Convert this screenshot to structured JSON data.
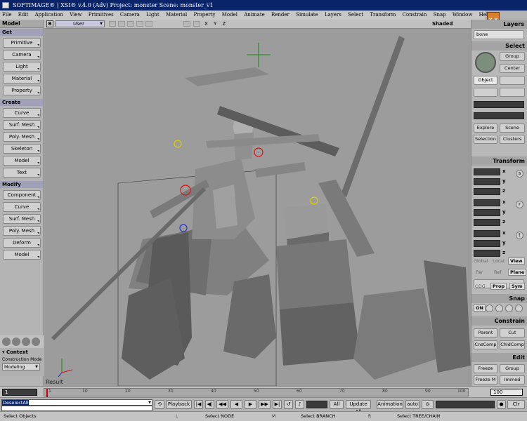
{
  "window": {
    "title": "SOFTIMAGE® | XSI® v.4.0 (Adv) Project: monster    Scene: monster_v1"
  },
  "menu": [
    "File",
    "Edit",
    "Application",
    "View",
    "Primitives",
    "Camera",
    "Light",
    "Material",
    "Property",
    "Model",
    "Animate",
    "Render",
    "Simulate",
    "Layers",
    "Select",
    "Transform",
    "Constrain",
    "Snap",
    "Window",
    "Help"
  ],
  "left_panel": {
    "title": "Model",
    "get_label": "Get",
    "get_buttons": [
      "Primitive",
      "Camera",
      "Light",
      "Material",
      "Property"
    ],
    "create_label": "Create",
    "create_buttons": [
      "Curve",
      "Surf. Mesh",
      "Poly. Mesh",
      "Skeleton",
      "Model",
      "Text"
    ],
    "modify_label": "Modify",
    "modify_buttons": [
      "Component",
      "Curve",
      "Surf. Mesh",
      "Poly. Mesh",
      "Deform",
      "Model"
    ],
    "context_label": "Context",
    "construction_mode_label": "Construction Mode",
    "construction_mode_value": "Modeling"
  },
  "viewport": {
    "view_label": "B",
    "camera": "User",
    "axes": "X Y Z",
    "display_mode": "Shaded",
    "result_label": "Result"
  },
  "right_panel": {
    "layers_title": "Layers",
    "layer_value": "bone",
    "select_title": "Select",
    "select_group": "Group",
    "select_center": "Center",
    "select_object": "Object",
    "explore": "Explore",
    "scene": "Scene",
    "selection": "Selection",
    "clusters": "Clusters",
    "transform_title": "Transform",
    "axes": [
      "x",
      "y",
      "z"
    ],
    "transform_tools": [
      "s",
      "r",
      "t"
    ],
    "global": "Global",
    "local": "Local",
    "view": "View",
    "par": "Par",
    "ref": "Ref",
    "plane": "Plane",
    "cog": "COG",
    "prop": "Prop",
    "sym": "Sym",
    "snap_title": "Snap",
    "snap_on": "ON",
    "constrain_title": "Constrain",
    "parent": "Parent",
    "cut": "Cut",
    "cnscomp": "CnsComp",
    "chldcomp": "ChldComp",
    "edit_title": "Edit",
    "freeze": "Freeze",
    "group": "Group",
    "freeze_m": "Freeze M",
    "immed": "Immed"
  },
  "timeline": {
    "start": "1",
    "end": "100",
    "ticks": [
      "1",
      "10",
      "20",
      "30",
      "40",
      "50",
      "60",
      "70",
      "80",
      "90",
      "100"
    ]
  },
  "playback": {
    "command": "DeselectAll",
    "playback_label": "Playback",
    "all_label": "All",
    "update_all": "Update All",
    "animation": "Animation",
    "auto": "auto",
    "clr": "Clr"
  },
  "status": {
    "left": "Select Objects",
    "key_l": "L",
    "node": "Select NODE",
    "key_m": "M",
    "branch": "Select BRANCH",
    "key_r": "R",
    "tree": "Select TREE/CHAIN"
  }
}
